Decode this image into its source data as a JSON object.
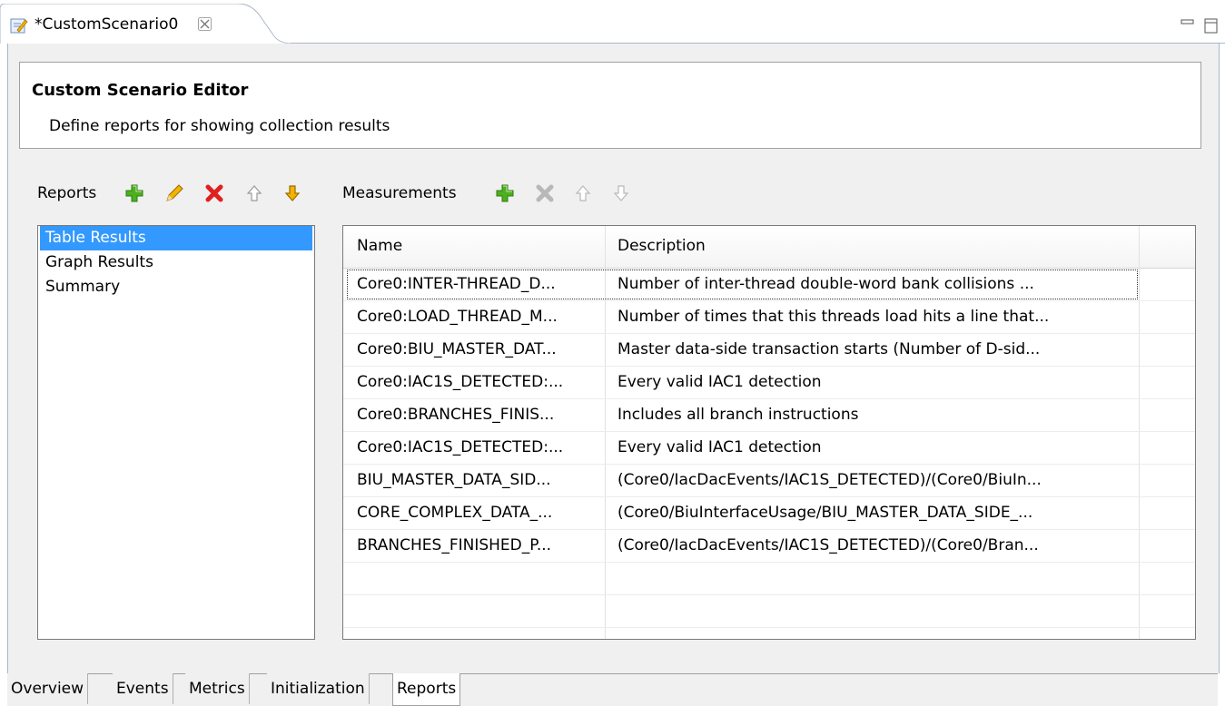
{
  "editor_tab": {
    "title": "*CustomScenario0",
    "icon": "edit-document-icon",
    "close_icon": "close-icon"
  },
  "view_controls": {
    "minimize_icon": "minimize-icon",
    "maximize_icon": "maximize-icon"
  },
  "header": {
    "title": "Custom Scenario Editor",
    "description": "Define reports for showing collection results"
  },
  "reports": {
    "label": "Reports",
    "toolbar_icons": [
      "add-icon",
      "edit-icon",
      "delete-icon",
      "move-up-icon",
      "move-down-icon"
    ],
    "items": [
      {
        "label": "Table Results",
        "selected": true
      },
      {
        "label": "Graph Results",
        "selected": false
      },
      {
        "label": "Summary",
        "selected": false
      }
    ]
  },
  "measurements": {
    "label": "Measurements",
    "toolbar_icons": [
      "add-icon",
      "delete-icon-disabled",
      "move-up-icon-disabled",
      "move-down-icon-disabled"
    ],
    "columns": [
      "Name",
      "Description"
    ],
    "rows": [
      {
        "name": "Core0:INTER-THREAD_D...",
        "description": "Number of inter-thread double-word bank collisions ..."
      },
      {
        "name": "Core0:LOAD_THREAD_M...",
        "description": "Number of times that this threads load hits a line that..."
      },
      {
        "name": "Core0:BIU_MASTER_DAT...",
        "description": "Master data-side transaction starts (Number of D-sid..."
      },
      {
        "name": "Core0:IAC1S_DETECTED:...",
        "description": "Every valid IAC1 detection"
      },
      {
        "name": "Core0:BRANCHES_FINIS...",
        "description": "Includes all branch instructions"
      },
      {
        "name": "Core0:IAC1S_DETECTED:...",
        "description": "Every valid IAC1 detection"
      },
      {
        "name": "BIU_MASTER_DATA_SID...",
        "description": "(Core0/IacDacEvents/IAC1S_DETECTED)/(Core0/BiuIn..."
      },
      {
        "name": "CORE_COMPLEX_DATA_...",
        "description": "(Core0/BiuInterfaceUsage/BIU_MASTER_DATA_SIDE_..."
      },
      {
        "name": "BRANCHES_FINISHED_P...",
        "description": "(Core0/IacDacEvents/IAC1S_DETECTED)/(Core0/Bran..."
      }
    ]
  },
  "page_tabs": [
    {
      "label": "Overview",
      "active": false
    },
    {
      "label": "Events",
      "active": false
    },
    {
      "label": "Metrics",
      "active": false
    },
    {
      "label": "Initialization",
      "active": false
    },
    {
      "label": "Reports",
      "active": true
    }
  ],
  "colors": {
    "selection": "#3399ff",
    "add_green": "#4caf20",
    "delete_red": "#e02020",
    "arrow_yellow": "#f2b400",
    "disabled_gray": "#b8b8b8"
  }
}
